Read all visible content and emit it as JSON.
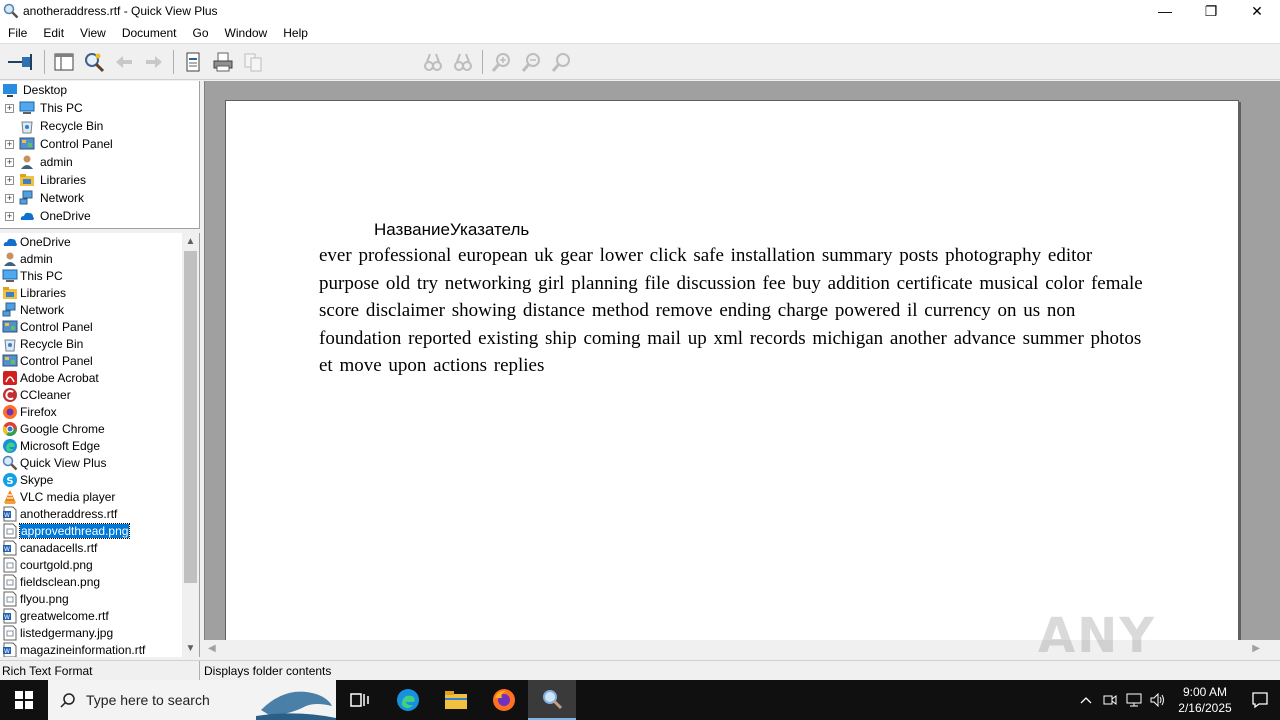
{
  "window": {
    "title": "anotheraddress.rtf - Quick View Plus",
    "minimize": "—",
    "maximize": "❐",
    "close": "✕"
  },
  "menu": [
    "File",
    "Edit",
    "View",
    "Document",
    "Go",
    "Window",
    "Help"
  ],
  "tree": [
    {
      "label": "Desktop",
      "icon": "desktop-icon",
      "expandable": false,
      "indent": 0
    },
    {
      "label": "This PC",
      "icon": "computer-icon",
      "expandable": true,
      "indent": 1
    },
    {
      "label": "Recycle Bin",
      "icon": "recycle-bin-icon",
      "expandable": false,
      "indent": 1
    },
    {
      "label": "Control Panel",
      "icon": "control-panel-icon",
      "expandable": true,
      "indent": 1
    },
    {
      "label": "admin",
      "icon": "user-icon",
      "expandable": true,
      "indent": 1
    },
    {
      "label": "Libraries",
      "icon": "libraries-icon",
      "expandable": true,
      "indent": 1
    },
    {
      "label": "Network",
      "icon": "network-icon",
      "expandable": true,
      "indent": 1
    },
    {
      "label": "OneDrive",
      "icon": "onedrive-icon",
      "expandable": true,
      "indent": 1
    }
  ],
  "files": [
    {
      "label": "OneDrive",
      "icon": "onedrive-icon"
    },
    {
      "label": "admin",
      "icon": "user-icon"
    },
    {
      "label": "This PC",
      "icon": "computer-icon"
    },
    {
      "label": "Libraries",
      "icon": "libraries-icon"
    },
    {
      "label": "Network",
      "icon": "network-icon"
    },
    {
      "label": "Control Panel",
      "icon": "control-panel-icon"
    },
    {
      "label": "Recycle Bin",
      "icon": "recycle-bin-icon"
    },
    {
      "label": "Control Panel",
      "icon": "control-panel-icon"
    },
    {
      "label": "Adobe Acrobat",
      "icon": "acrobat-icon"
    },
    {
      "label": "CCleaner",
      "icon": "ccleaner-icon"
    },
    {
      "label": "Firefox",
      "icon": "firefox-icon"
    },
    {
      "label": "Google Chrome",
      "icon": "chrome-icon"
    },
    {
      "label": "Microsoft Edge",
      "icon": "edge-icon"
    },
    {
      "label": "Quick View Plus",
      "icon": "magnifier-icon"
    },
    {
      "label": "Skype",
      "icon": "skype-icon"
    },
    {
      "label": "VLC media player",
      "icon": "vlc-icon"
    },
    {
      "label": "anotheraddress.rtf",
      "icon": "rtf-file-icon"
    },
    {
      "label": "approvedthread.png",
      "icon": "image-file-icon",
      "selected": true
    },
    {
      "label": "canadacells.rtf",
      "icon": "rtf-file-icon"
    },
    {
      "label": "courtgold.png",
      "icon": "image-file-icon"
    },
    {
      "label": "fieldsclean.png",
      "icon": "image-file-icon"
    },
    {
      "label": "flyou.png",
      "icon": "image-file-icon"
    },
    {
      "label": "greatwelcome.rtf",
      "icon": "rtf-file-icon"
    },
    {
      "label": "listedgermany.jpg",
      "icon": "image-file-icon"
    },
    {
      "label": "magazineinformation.rtf",
      "icon": "rtf-file-icon"
    }
  ],
  "document": {
    "heading": "НазваниеУказатель",
    "body": "ever professional european uk  gear lower  click safe installation  summary posts   photography editor purpose    old try networking girl planning file   discussion fee buy     addition certificate musical color female   score disclaimer showing distance method remove   ending charge  powered il    currency on us    non foundation   reported existing ship coming mail up    xml  records michigan another advance summer photos et move upon actions  replies"
  },
  "status": {
    "left": "Rich Text Format",
    "right": "Displays folder contents"
  },
  "watermark": "ANY RUN",
  "taskbar": {
    "search_placeholder": "Type here to search",
    "time": "9:00 AM",
    "date": "2/16/2025"
  },
  "colors": {
    "selection": "#0078d7",
    "viewer_bg": "#a0a0a0",
    "taskbar": "#101010"
  }
}
